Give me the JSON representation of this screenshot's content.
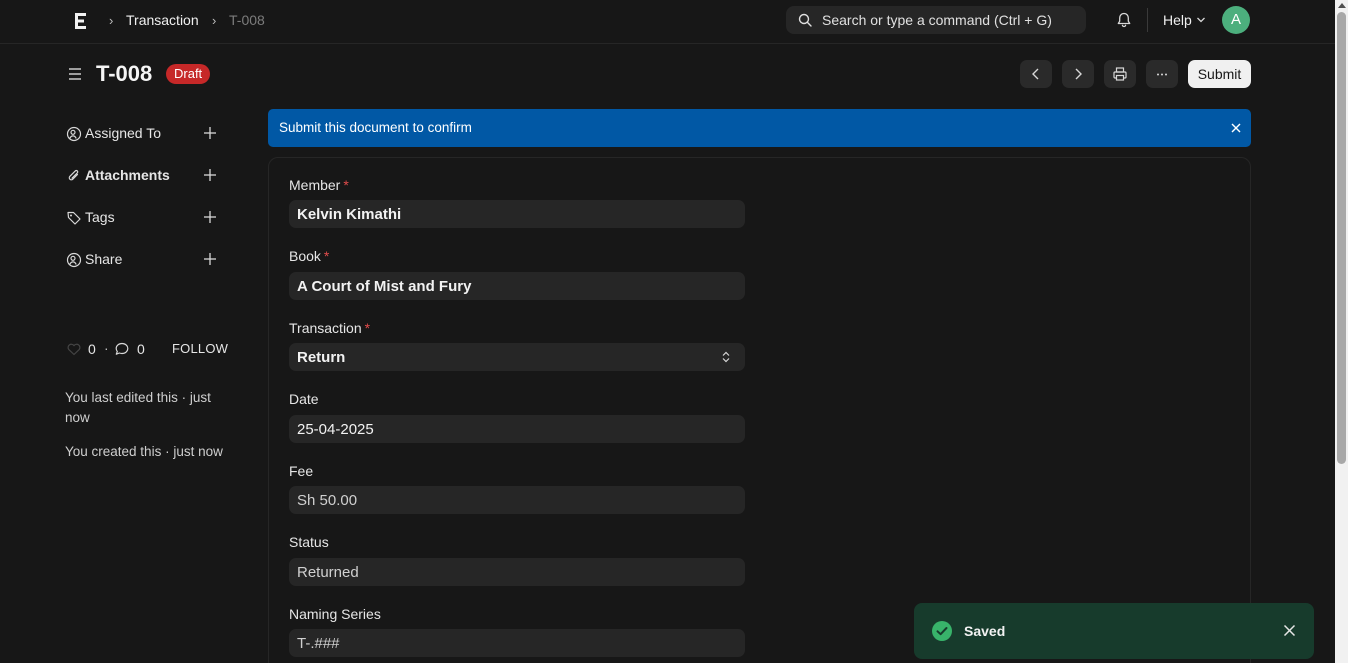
{
  "navbar": {
    "logo_icon": "frappe-logo-icon",
    "breadcrumbs": [
      "Transaction",
      "T-008"
    ],
    "search_placeholder": "Search or type a command (Ctrl + G)",
    "help_label": "Help",
    "avatar_initial": "A",
    "avatar_color": "#4caf7d"
  },
  "header": {
    "title": "T-008",
    "status_badge": "Draft",
    "submit_label": "Submit"
  },
  "sidebar": {
    "items": [
      {
        "label": "Assigned To",
        "icon": "assign-user-icon"
      },
      {
        "label": "Attachments",
        "icon": "paperclip-icon"
      },
      {
        "label": "Tags",
        "icon": "tag-icon"
      },
      {
        "label": "Share",
        "icon": "share-user-icon"
      }
    ],
    "likes_count": "0",
    "comments_count": "0",
    "follow_label": "FOLLOW",
    "last_edited": "You last edited this · just now",
    "created": "You created this · just now"
  },
  "banner": {
    "text": "Submit this document to confirm",
    "color": "#0158a5"
  },
  "form": {
    "fields": [
      {
        "label": "Member",
        "required": true,
        "value": "Kelvin Kimathi"
      },
      {
        "label": "Book",
        "required": true,
        "value": "A Court of Mist and Fury"
      },
      {
        "label": "Transaction",
        "required": true,
        "value": "Return"
      },
      {
        "label": "Date",
        "required": false,
        "value": "25-04-2025"
      },
      {
        "label": "Fee",
        "required": false,
        "value": "Sh 50.00"
      },
      {
        "label": "Status",
        "required": false,
        "value": "Returned"
      },
      {
        "label": "Naming Series",
        "required": false,
        "value": "T-.###"
      }
    ],
    "required_mark": "*"
  },
  "toast": {
    "text": "Saved",
    "color": "#173b2c"
  }
}
